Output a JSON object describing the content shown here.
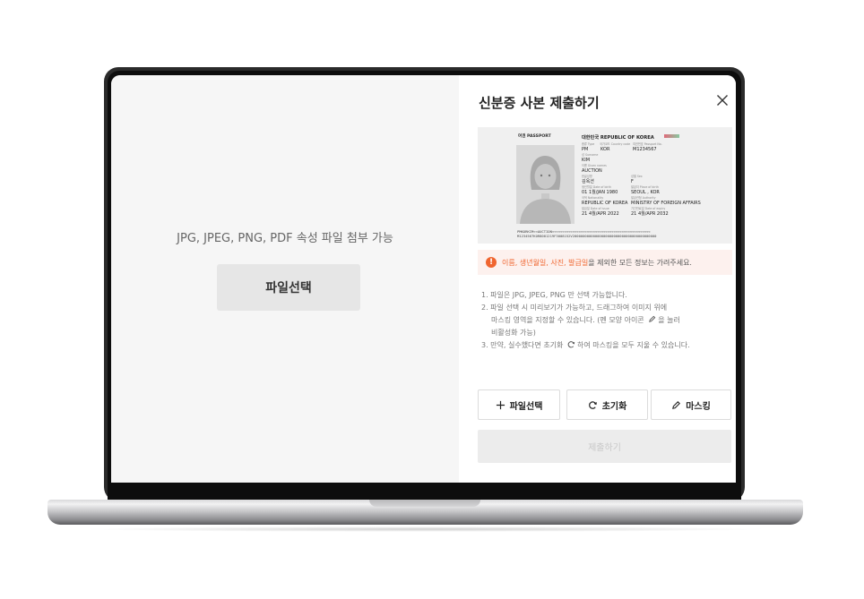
{
  "left": {
    "hint": "JPG, JPEG, PNG, PDF 속성 파일 첨부 가능",
    "select_button": "파일선택"
  },
  "dialog": {
    "title": "신분증 사본 제출하기",
    "close_icon": "close-icon"
  },
  "passport": {
    "doc_label": "여권 PASSPORT",
    "country_title": "대한민국 REPUBLIC OF KOREA",
    "type_label": "종류 Type",
    "type": "PM",
    "code_label": "국가코드 Country code",
    "code": "KOR",
    "passport_no_label": "여권번호 Passport No.",
    "passport_no": "M1234567",
    "surname_label": "성 Surname",
    "surname": "KIM",
    "given_label": "이름 Given names",
    "given": "AUCTION",
    "korean_name_label": "한글성명",
    "korean_name": "김옥션",
    "sex_label": "성별 Sex",
    "sex": "F",
    "dob_label": "생년월일 Date of birth",
    "dob": "01 1월/JAN 1980",
    "pob_label": "발급지 Place of birth",
    "pob": "SEOUL , KOR",
    "nationality_label": "국적 Nationality",
    "nationality": "REPUBLIC OF KOREA",
    "authority_label": "발급관청 Authority",
    "authority": "MINISTRY OF FOREIGN AFFAIRS",
    "issue_label": "발급일 Date of issue",
    "issue": "21 4월/APR 2022",
    "expiry_label": "기간만료일 Date of expiry",
    "expiry": "21 4월/APR 2032",
    "mrz1": "PMKORKIM<<AUCTION<<<<<<<<<<<<<<<<<<<<<<<<<<<<<<<<<<<<<<<<<<<<<<<<",
    "mrz2": "M1234567KOR8001219F3008152V20000000000000000000000000000000000000000"
  },
  "notice": {
    "icon": "warning-icon",
    "highlight": "이름, 생년월일, 사진, 발급일",
    "rest": "을 제외한 모든 정보는 가려주세요."
  },
  "guide": {
    "line1": "1. 파일은 JPG, JPEG, PNG 만 선택 가능합니다.",
    "line2a": "2. 파일 선택 시 미리보기가 가능하고, 드래그하여 이미지 위에",
    "line2b": "마스킹 영역을 지정할 수 있습니다. (펜 모양 아이콘",
    "line2c": "을 눌러",
    "line2d": "비활성화 가능)",
    "line3a": "3. 만약, 실수했다면 초기화",
    "line3b": "하여 마스킹을 모두 지울 수 있습니다."
  },
  "actions": {
    "select": "파일선택",
    "reset": "초기화",
    "mask": "마스킹"
  },
  "submit": "제출하기",
  "colors": {
    "accent": "#f0652f",
    "notice_bg": "#fdf1ee"
  }
}
